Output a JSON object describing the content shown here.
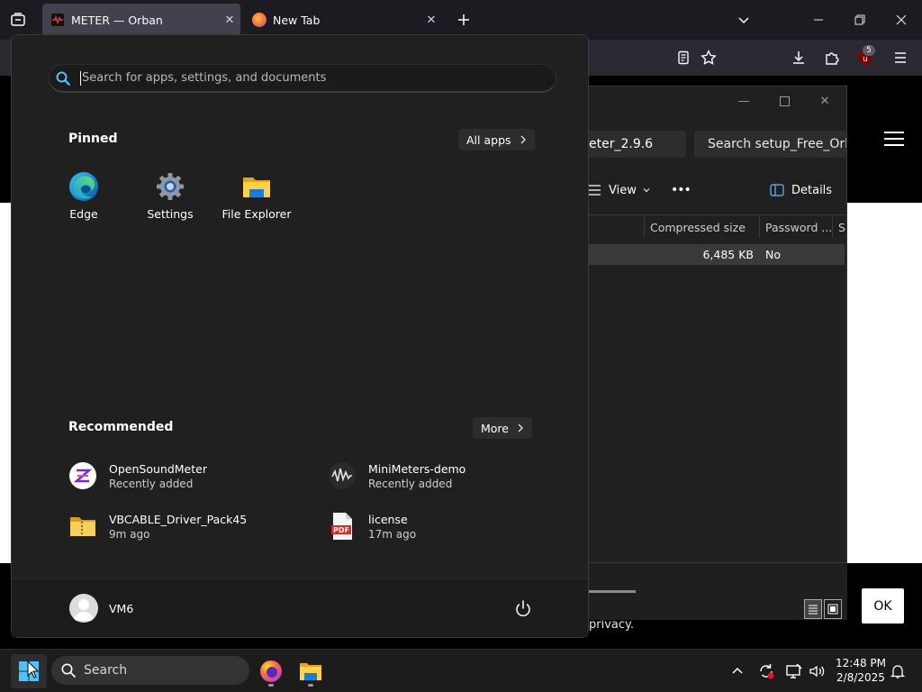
{
  "browser": {
    "tabs": [
      {
        "title": "METER — Orban",
        "active": true
      },
      {
        "title": "New Tab",
        "active": false
      }
    ],
    "extension_badge": "5"
  },
  "webpage": {
    "privacy_text": "privacy.",
    "ok_label": "OK"
  },
  "explorer": {
    "address_fragment": "eter_2.9.6",
    "search_placeholder": "Search setup_Free_Orban",
    "toolbar": {
      "view": "View",
      "more": "•••",
      "details": "Details"
    },
    "columns": [
      "Compressed size",
      "Password ...",
      "Si"
    ],
    "row": {
      "compressed_size": "6,485 KB",
      "password": "No"
    }
  },
  "start_menu": {
    "search_placeholder": "Search for apps, settings, and documents",
    "pinned_title": "Pinned",
    "all_apps_label": "All apps",
    "pinned": [
      {
        "label": "Edge",
        "icon": "edge-icon"
      },
      {
        "label": "Settings",
        "icon": "settings-gear-icon"
      },
      {
        "label": "File Explorer",
        "icon": "folder-icon"
      }
    ],
    "recommended_title": "Recommended",
    "more_label": "More",
    "recommended": [
      {
        "name": "OpenSoundMeter",
        "sub": "Recently added",
        "icon": "opensoundmeter-icon"
      },
      {
        "name": "MiniMeters-demo",
        "sub": "Recently added",
        "icon": "minimeters-icon"
      },
      {
        "name": "VBCABLE_Driver_Pack45",
        "sub": "9m ago",
        "icon": "zip-folder-icon"
      },
      {
        "name": "license",
        "sub": "17m ago",
        "icon": "pdf-icon"
      }
    ],
    "user": "VM6"
  },
  "taskbar": {
    "search_label": "Search",
    "time": "12:48 PM",
    "date": "2/8/2025"
  },
  "colors": {
    "start_bg": "#202020",
    "taskbar_bg": "#1c1c1c",
    "accent_blue": "#4cc2ff",
    "tab_active": "#42414d"
  }
}
